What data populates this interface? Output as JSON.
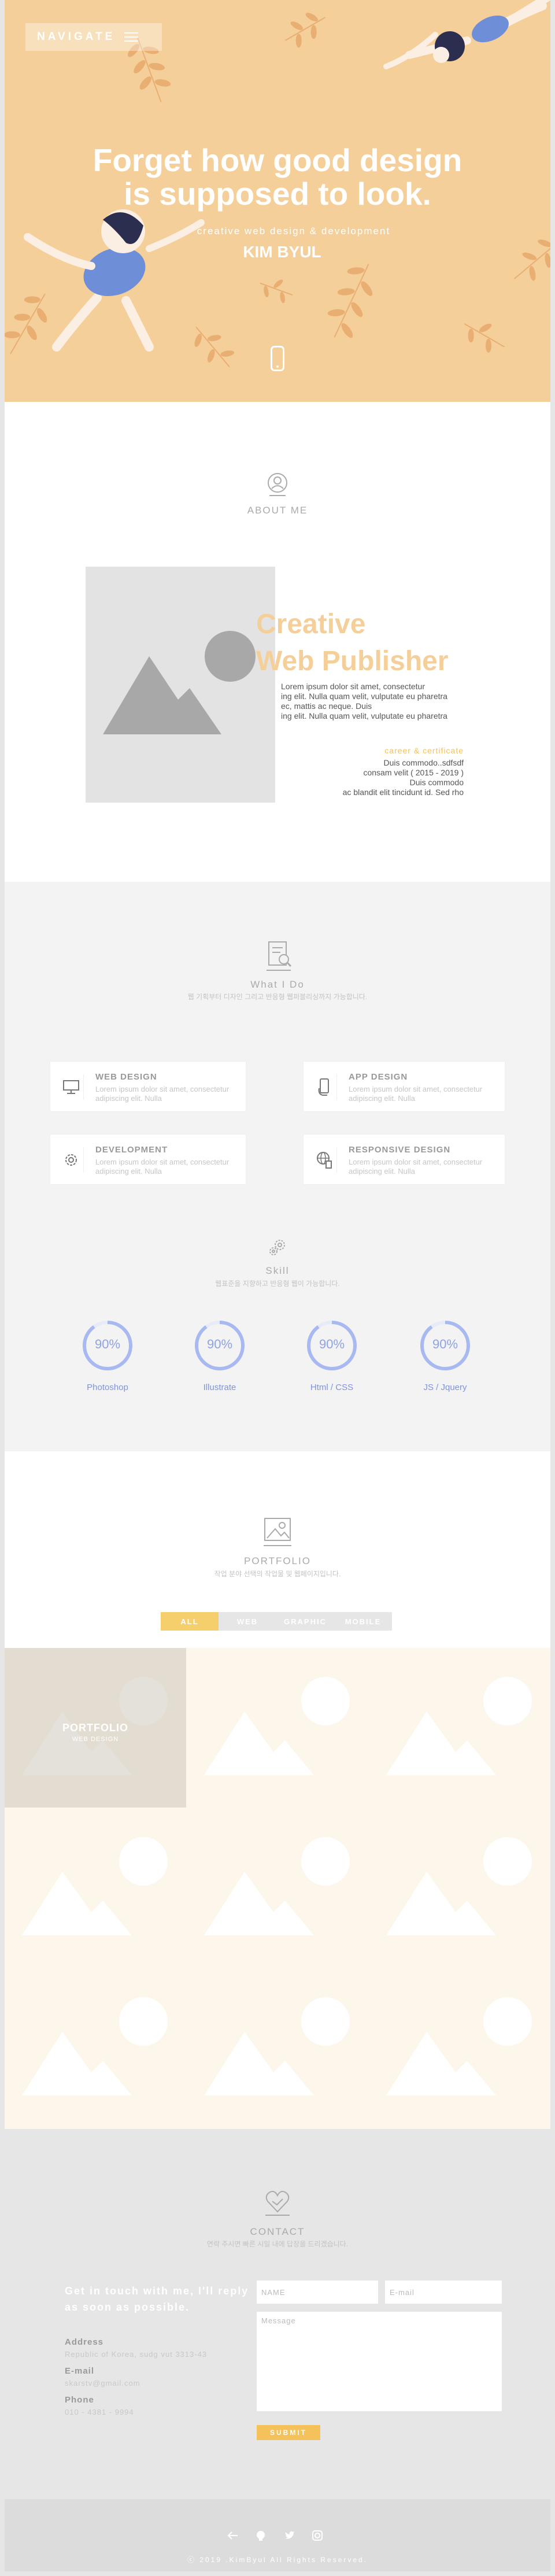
{
  "hero": {
    "nav_label": "NAVIGATE",
    "title_line1": "Forget how good design",
    "title_line2": "is supposed to look.",
    "subtitle": "creative web design & development",
    "name": "KIM BYUL"
  },
  "about": {
    "title": "ABOUT ME",
    "heading_line1": "Creative",
    "heading_line2": "Web Publisher",
    "paragraph": [
      "Lorem ipsum dolor sit amet, consectetur",
      "ing elit. Nulla quam velit, vulputate eu pharetra",
      "ec, mattis ac neque. Duis",
      "ing elit. Nulla quam velit, vulputate eu pharetra"
    ],
    "career_title": "career & certificate",
    "career_lines": [
      "Duis commodo..sdfsdf",
      "consam velit ( 2015 - 2019 )",
      "Duis commodo",
      "ac blandit elit tincidunt id. Sed rho"
    ]
  },
  "services": {
    "title": "What I Do",
    "desc": "웹 기획부터 디자인 그리고 반응형 웹퍼블리싱까지 가능합니다.",
    "items": [
      {
        "name": "WEB DESIGN",
        "desc": "Lorem ipsum dolor sit amet, consectetur adipiscing elit. Nulla",
        "icon": "monitor-icon"
      },
      {
        "name": "APP DESIGN",
        "desc": "Lorem ipsum dolor sit amet, consectetur adipiscing elit. Nulla",
        "icon": "mobile-hand-icon"
      },
      {
        "name": "DEVELOPMENT",
        "desc": "Lorem ipsum dolor sit amet, consectetur adipiscing elit. Nulla",
        "icon": "gear-icon"
      },
      {
        "name": "RESPONSIVE DESIGN",
        "desc": "Lorem ipsum dolor sit amet, consectetur adipiscing elit. Nulla",
        "icon": "globe-device-icon"
      }
    ],
    "skill_title": "Skill",
    "skill_desc": "웹표준을 지향하고 반응형 웹이 가능합니다.",
    "skills": [
      {
        "name": "Photoshop",
        "percent": 90,
        "label": "90%"
      },
      {
        "name": "Illustrate",
        "percent": 90,
        "label": "90%"
      },
      {
        "name": "Html  /  CSS",
        "percent": 90,
        "label": "90%"
      },
      {
        "name": "JS  /  Jquery",
        "percent": 90,
        "label": "90%"
      }
    ],
    "ring_color": "#a7b9f0"
  },
  "portfolio": {
    "title": "PORTFOLIO",
    "desc": "작업 분야 선택의 작업물 및 웹페이지입니다.",
    "tabs": [
      "ALL",
      "WEB",
      "GRAPHIC",
      "MOBILE"
    ],
    "active_tab": "ALL",
    "hover_title": "PORTFOLIO",
    "hover_sub": "WEB DESIGN"
  },
  "contact": {
    "title": "CONTACT",
    "desc": "연락 주시면 빠른 시일 내에 답장을 드리겠습니다.",
    "heading": "Get in touch with me, I'll reply as soon as possible.",
    "address_label": "Address",
    "address_value": "Republic of Korea, sudg vut  3313-43",
    "email_label": "E-mail",
    "email_value": "skarstv@gmail.com",
    "phone_label": "Phone",
    "phone_value": "010 - 4381 - 9994",
    "name_placeholder": "NAME",
    "email_placeholder": "E-mail",
    "message_placeholder": "Message",
    "submit_label": "SUBMIT"
  },
  "footer": {
    "copyright": "ⓒ 2019 .KimByul All Rights Reserved."
  },
  "colors": {
    "hero_bg": "#f5cf9a",
    "accent": "#f5c15b",
    "skill": "#8ea2e6"
  }
}
